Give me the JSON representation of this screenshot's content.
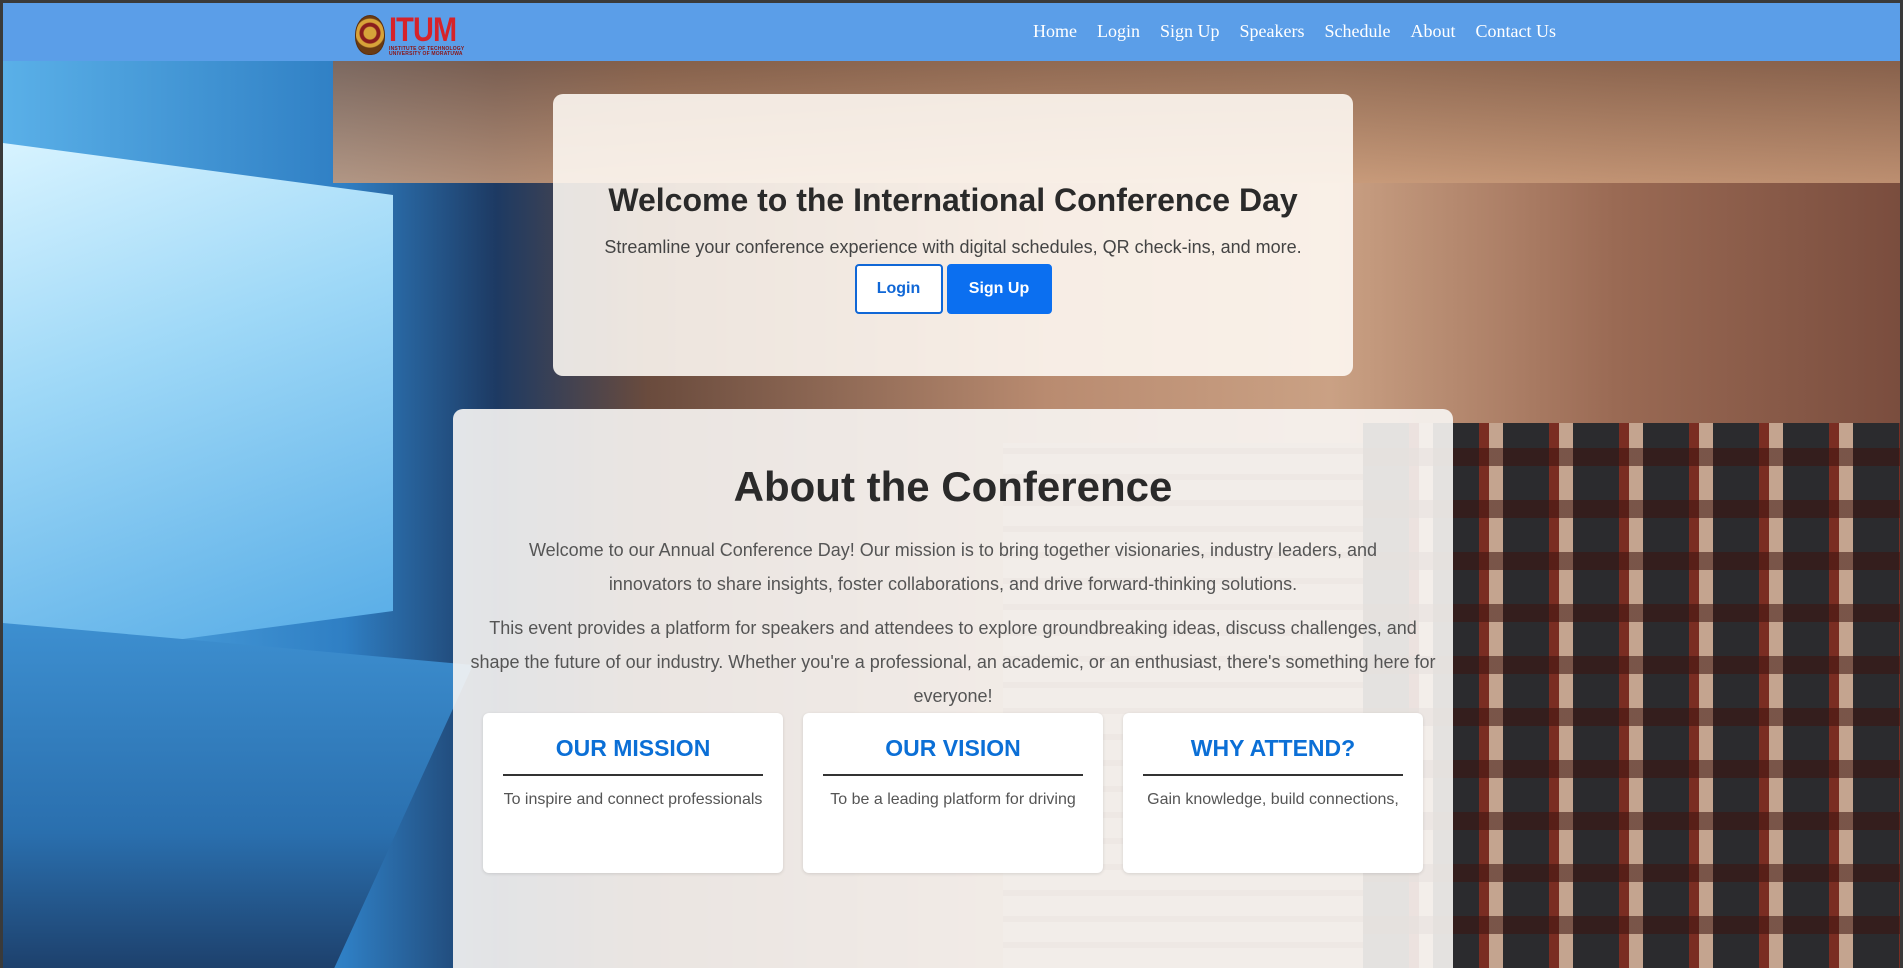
{
  "brand": {
    "logo_title": "ITUM",
    "logo_subtitle_1": "INSTITUTE OF TECHNOLOGY",
    "logo_subtitle_2": "UNIVERSITY OF MORATUWA",
    "navbar_color": "#5b9ee8",
    "accent": "#0b6ff0"
  },
  "nav": {
    "items": [
      {
        "label": "Home"
      },
      {
        "label": "Login"
      },
      {
        "label": "Sign Up"
      },
      {
        "label": "Speakers"
      },
      {
        "label": "Schedule"
      },
      {
        "label": "About"
      },
      {
        "label": "Contact Us"
      }
    ]
  },
  "hero": {
    "title": "Welcome to the International Conference Day",
    "subtitle": "Streamline your conference experience with digital schedules, QR check-ins, and more.",
    "login_label": "Login",
    "signup_label": "Sign Up"
  },
  "about": {
    "title": "About the Conference",
    "paragraph_1": "Welcome to our Annual Conference Day! Our mission is to bring together visionaries, industry leaders, and innovators to share insights, foster collaborations, and drive forward-thinking solutions.",
    "paragraph_2": "This event provides a platform for speakers and attendees to explore groundbreaking ideas, discuss challenges, and shape the future of our industry. Whether you're a professional, an academic, or an enthusiast, there's something here for everyone!",
    "cards": [
      {
        "title": "OUR MISSION",
        "text": "To inspire and connect professionals"
      },
      {
        "title": "OUR VISION",
        "text": "To be a leading platform for driving"
      },
      {
        "title": "WHY ATTEND?",
        "text": "Gain knowledge, build connections,"
      }
    ]
  }
}
